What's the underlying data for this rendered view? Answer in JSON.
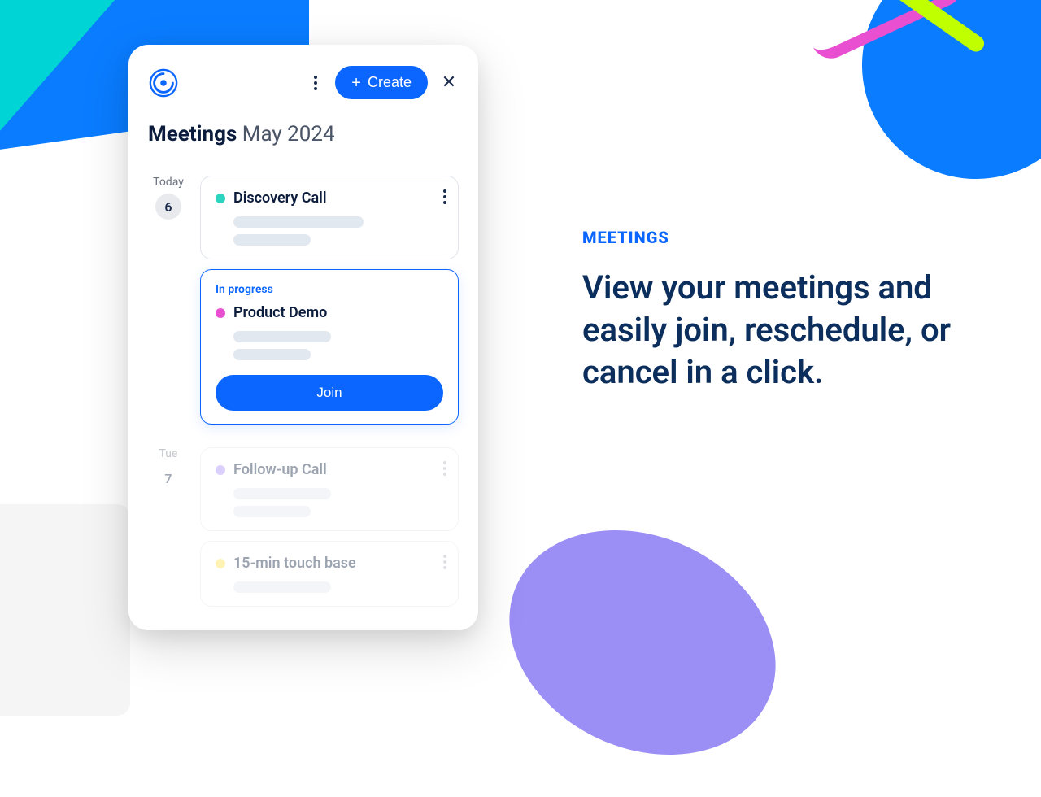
{
  "header": {
    "create_label": "Create"
  },
  "page": {
    "title_bold": "Meetings",
    "title_light": "May 2024"
  },
  "days": [
    {
      "label": "Today",
      "num": "6",
      "meetings": [
        {
          "title": "Discovery Call",
          "dot": "teal"
        },
        {
          "status": "In progress",
          "title": "Product Demo",
          "dot": "magenta",
          "join_label": "Join"
        }
      ]
    },
    {
      "label": "Tue",
      "num": "7",
      "meetings": [
        {
          "title": "Follow-up Call",
          "dot": "purple"
        },
        {
          "title": "15-min touch base",
          "dot": "yellow"
        }
      ]
    }
  ],
  "marketing": {
    "eyebrow": "MEETINGS",
    "headline": "View your meetings and easily join, reschedule, or cancel in a click."
  }
}
